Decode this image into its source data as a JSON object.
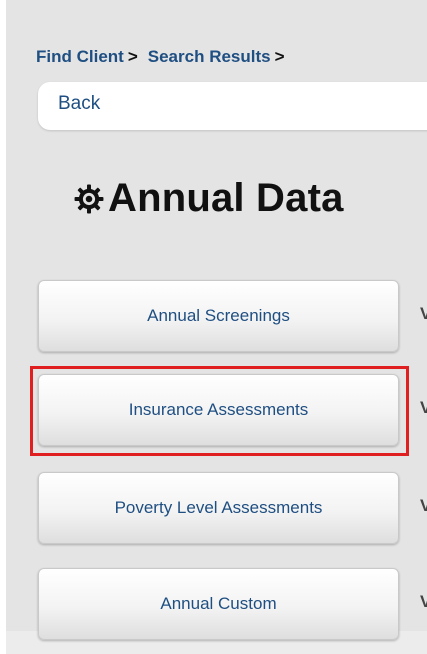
{
  "breadcrumb": {
    "items": [
      {
        "label": "Find Client",
        "sep": ">"
      },
      {
        "label": "Search Results",
        "sep": ">"
      }
    ]
  },
  "back": {
    "label": "Back"
  },
  "page": {
    "title": "Annual Data",
    "title_icon": "gear-icon"
  },
  "buttons": [
    {
      "label": "Annual Screenings",
      "edge": "V"
    },
    {
      "label": "Insurance Assessments",
      "edge": "V",
      "highlighted": true
    },
    {
      "label": "Poverty Level Assessments",
      "edge": "V"
    },
    {
      "label": "Annual Custom",
      "edge": "V"
    }
  ],
  "colors": {
    "link": "#1f4f82",
    "panel_background": "#e4e4e4",
    "highlight": "#e02020",
    "title": "#111111"
  }
}
